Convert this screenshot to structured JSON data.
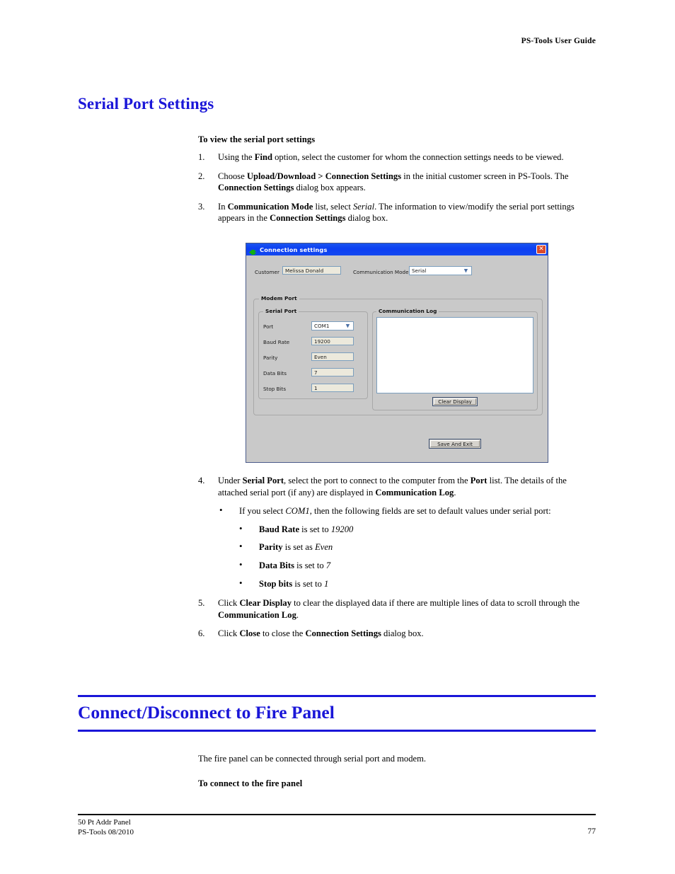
{
  "page": {
    "running_head": "PS-Tools User Guide",
    "footer_line1": "50 Pt Addr  Panel",
    "footer_line2": "PS-Tools  08/2010",
    "page_number": "77",
    "heading_color": "#1a16d8"
  },
  "section1": {
    "heading": "Serial Port Settings",
    "procedure_heading": "To view the serial port settings",
    "steps": [
      {
        "number": "1.",
        "parts": [
          {
            "t": "Using the ",
            "s": "n"
          },
          {
            "t": "Find",
            "s": "b"
          },
          {
            "t": " option, select the customer for whom the connection settings needs to be viewed.",
            "s": "n"
          }
        ]
      },
      {
        "number": "2.",
        "parts": [
          {
            "t": "Choose ",
            "s": "n"
          },
          {
            "t": "Upload/Download > Connection Settings",
            "s": "b"
          },
          {
            "t": " in the initial customer screen in PS-Tools. The ",
            "s": "n"
          },
          {
            "t": "Connection Settings",
            "s": "b"
          },
          {
            "t": " dialog box appears.",
            "s": "n"
          }
        ]
      },
      {
        "number": "3.",
        "parts": [
          {
            "t": "In ",
            "s": "n"
          },
          {
            "t": "Communication Mode",
            "s": "b"
          },
          {
            "t": " list, select ",
            "s": "n"
          },
          {
            "t": "Serial",
            "s": "i"
          },
          {
            "t": ". The information to view/modify the serial port settings appears in the ",
            "s": "n"
          },
          {
            "t": "Connection Settings",
            "s": "b"
          },
          {
            "t": " dialog box.",
            "s": "n"
          }
        ]
      },
      {
        "number": "4.",
        "parts": [
          {
            "t": "Under ",
            "s": "n"
          },
          {
            "t": "Serial Port",
            "s": "b"
          },
          {
            "t": ", select the port to connect to the computer from the ",
            "s": "n"
          },
          {
            "t": "Port",
            "s": "b"
          },
          {
            "t": " list. The details of the attached serial port (if any) are displayed in ",
            "s": "n"
          },
          {
            "t": "Communication Log",
            "s": "b"
          },
          {
            "t": ".",
            "s": "n"
          }
        ]
      },
      {
        "number": "5.",
        "parts": [
          {
            "t": "Click ",
            "s": "n"
          },
          {
            "t": "Clear Display",
            "s": "b"
          },
          {
            "t": " to clear the displayed data if there are multiple lines of data to scroll through the ",
            "s": "n"
          },
          {
            "t": "Communication Log",
            "s": "b"
          },
          {
            "t": ".",
            "s": "n"
          }
        ]
      },
      {
        "number": "6.",
        "parts": [
          {
            "t": "Click ",
            "s": "n"
          },
          {
            "t": "Close",
            "s": "b"
          },
          {
            "t": " to close the ",
            "s": "n"
          },
          {
            "t": "Connection Settings",
            "s": "b"
          },
          {
            "t": " dialog box.",
            "s": "n"
          }
        ]
      }
    ],
    "bullet_lead": {
      "marker": "•",
      "parts": [
        {
          "t": "If you select ",
          "s": "n"
        },
        {
          "t": "COM1,",
          "s": "i"
        },
        {
          "t": " then the following fields are set to default values under serial port:",
          "s": "n"
        }
      ]
    },
    "sub_bullets": [
      {
        "marker": "•",
        "parts": [
          {
            "t": "Baud Rate",
            "s": "b"
          },
          {
            "t": " is set to ",
            "s": "n"
          },
          {
            "t": "19200",
            "s": "i"
          }
        ]
      },
      {
        "marker": "•",
        "parts": [
          {
            "t": "Parity",
            "s": "b"
          },
          {
            "t": " is set as ",
            "s": "n"
          },
          {
            "t": "Even",
            "s": "i"
          }
        ]
      },
      {
        "marker": "•",
        "parts": [
          {
            "t": "Data Bits",
            "s": "b"
          },
          {
            "t": " is set to ",
            "s": "n"
          },
          {
            "t": "7",
            "s": "i"
          }
        ]
      },
      {
        "marker": "•",
        "parts": [
          {
            "t": "Stop bits",
            "s": "b"
          },
          {
            "t": " is set to ",
            "s": "n"
          },
          {
            "t": "1",
            "s": "i"
          }
        ]
      }
    ]
  },
  "dialog": {
    "title": "Connection settings",
    "title_icon": "plug-connect-icon",
    "close_label": "✕",
    "titlebar_color": "#0c3ff2",
    "body_color": "#c9c9c9",
    "customer_label": "Customer",
    "customer_value": "Melissa Donald",
    "comm_mode_label": "Communication Mode",
    "comm_mode_value": "Serial",
    "modem_port_group": "Modem Port",
    "serial_port_group": "Serial Port",
    "comm_log_group": "Communication Log",
    "log_contents": "",
    "fields": [
      {
        "label": "Port",
        "value": "COM1",
        "type": "combobox"
      },
      {
        "label": "Baud Rate",
        "value": "19200",
        "type": "textbox"
      },
      {
        "label": "Parity",
        "value": "Even",
        "type": "textbox"
      },
      {
        "label": "Data Bits",
        "value": "7",
        "type": "textbox"
      },
      {
        "label": "Stop Bits",
        "value": "1",
        "type": "textbox"
      }
    ],
    "clear_display_button": "Clear Display",
    "save_exit_button": "Save And Exit"
  },
  "section2": {
    "heading": "Connect/Disconnect to Fire Panel",
    "intro": "The fire panel can be connected through serial port and modem.",
    "procedure_heading": "To connect to the fire panel"
  }
}
